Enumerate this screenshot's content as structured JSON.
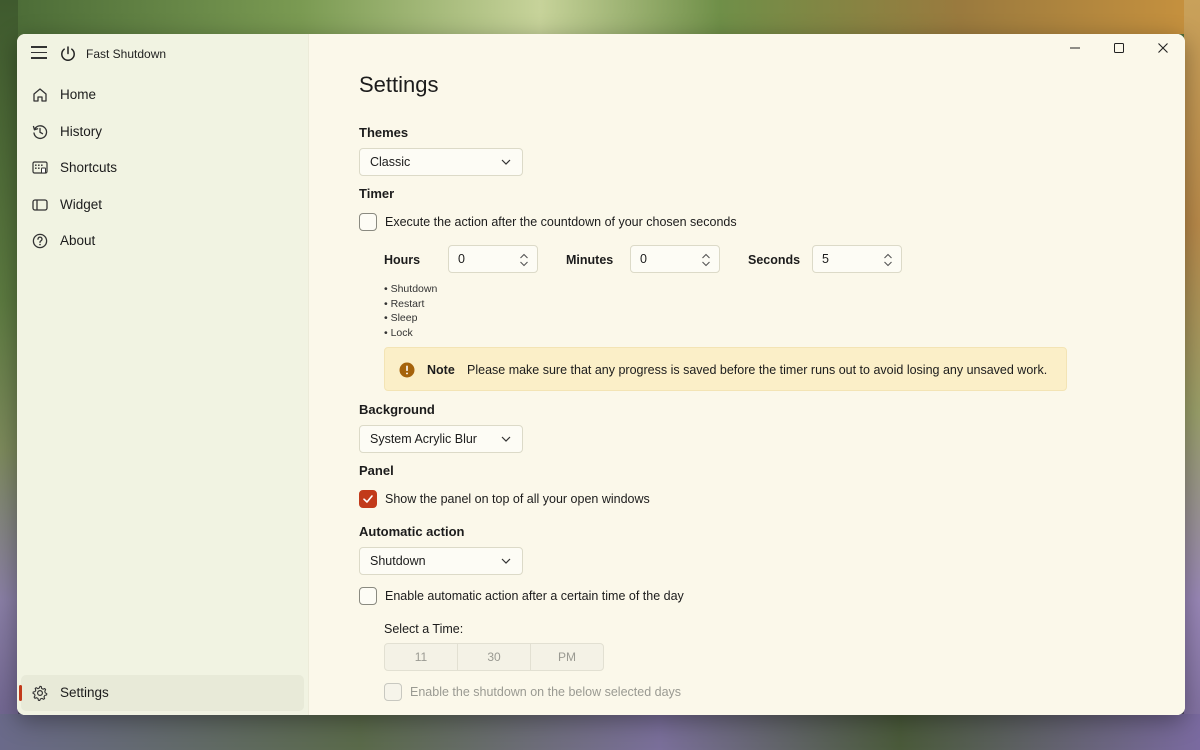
{
  "app": {
    "title": "Fast Shutdown"
  },
  "sidebar": {
    "items": [
      {
        "label": "Home"
      },
      {
        "label": "History"
      },
      {
        "label": "Shortcuts"
      },
      {
        "label": "Widget"
      },
      {
        "label": "About"
      }
    ],
    "settings_label": "Settings"
  },
  "page": {
    "title": "Settings"
  },
  "themes": {
    "label": "Themes",
    "selected": "Classic"
  },
  "timer": {
    "label": "Timer",
    "checkbox_label": "Execute the action after the countdown of your chosen seconds",
    "checked": false,
    "hours_label": "Hours",
    "hours_value": "0",
    "minutes_label": "Minutes",
    "minutes_value": "0",
    "seconds_label": "Seconds",
    "seconds_value": "5",
    "actions": [
      "• Shutdown",
      "• Restart",
      "• Sleep",
      "• Lock"
    ]
  },
  "note": {
    "title": "Note",
    "text": "Please make sure that any progress is saved before the timer runs out to avoid losing any unsaved work."
  },
  "background": {
    "label": "Background",
    "selected": "System Acrylic Blur"
  },
  "panel": {
    "label": "Panel",
    "checkbox_label": "Show the panel on top of all your open windows",
    "checked": true
  },
  "automatic_action": {
    "label": "Automatic action",
    "selected": "Shutdown",
    "checkbox_label": "Enable automatic action after a certain time of the day",
    "checked": false,
    "select_time_label": "Select a Time:",
    "time": {
      "hour": "11",
      "minute": "30",
      "period": "PM"
    },
    "days_checkbox_label": "Enable the shutdown on the below selected days"
  },
  "colors": {
    "accent": "#c23a1a",
    "note_bg": "#fbefc8",
    "note_icon": "#a5630c"
  },
  "icons": {
    "menu": "hamburger-icon",
    "app": "power-icon",
    "home": "home-icon",
    "history": "history-icon",
    "shortcuts": "keyboard-icon",
    "widget": "widget-icon",
    "about": "help-icon",
    "settings": "gear-icon",
    "note": "warning-icon"
  }
}
